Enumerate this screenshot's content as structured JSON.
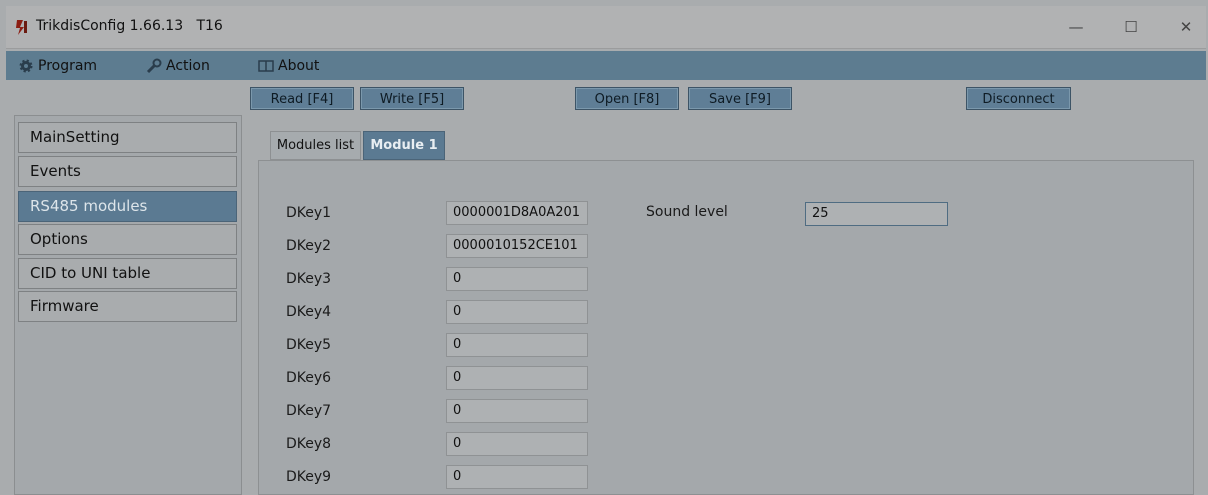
{
  "window": {
    "title": "TrikdisConfig 1.66.13   T16",
    "minimize": "—",
    "maximize": "☐",
    "close": "✕"
  },
  "menu": {
    "program": "Program",
    "action": "Action",
    "about": "About"
  },
  "toolbar": {
    "read": "Read [F4]",
    "write": "Write [F5]",
    "open": "Open [F8]",
    "save": "Save [F9]",
    "disconnect": "Disconnect"
  },
  "sidebar": {
    "items": [
      {
        "label": "MainSetting"
      },
      {
        "label": "Events"
      },
      {
        "label": "RS485 modules"
      },
      {
        "label": "Options"
      },
      {
        "label": "CID to UNI table"
      },
      {
        "label": "Firmware"
      }
    ],
    "active_index": 2
  },
  "tabs": [
    {
      "label": "Modules list"
    },
    {
      "label": "Module 1"
    }
  ],
  "dkeys": [
    {
      "label": "DKey1",
      "value": "0000001D8A0A201"
    },
    {
      "label": "DKey2",
      "value": "0000010152CE101"
    },
    {
      "label": "DKey3",
      "value": "0"
    },
    {
      "label": "DKey4",
      "value": "0"
    },
    {
      "label": "DKey5",
      "value": "0"
    },
    {
      "label": "DKey6",
      "value": "0"
    },
    {
      "label": "DKey7",
      "value": "0"
    },
    {
      "label": "DKey8",
      "value": "0"
    },
    {
      "label": "DKey9",
      "value": "0"
    }
  ],
  "sound": {
    "label": "Sound level",
    "value": "25"
  },
  "colors": {
    "accent": "#5b7a92",
    "menubar": "#5d7c90",
    "background": "#a9acae"
  }
}
